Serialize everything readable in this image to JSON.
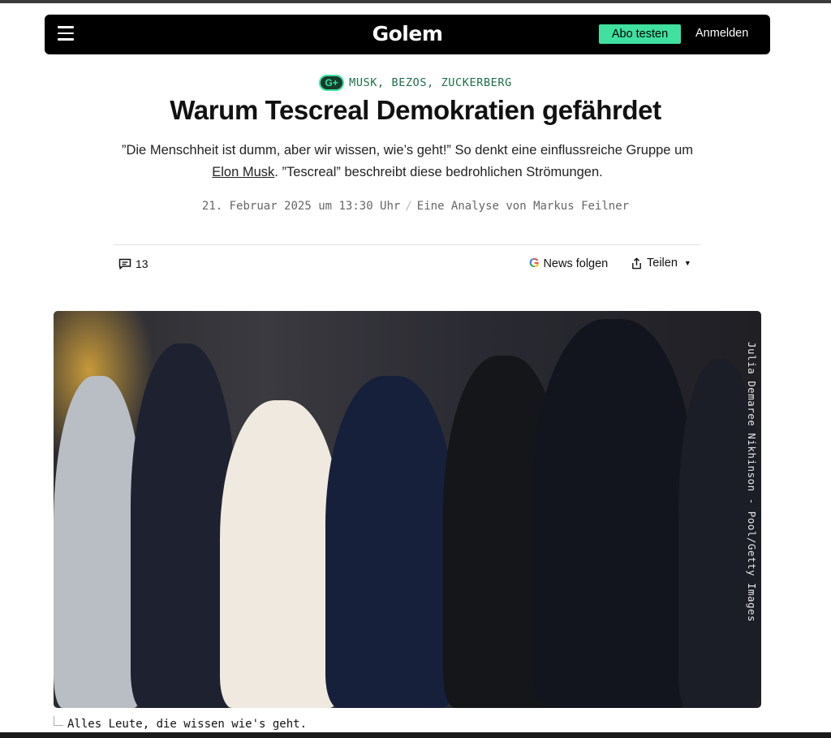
{
  "header": {
    "logo": "Golem",
    "subscribe_label": "Abo testen",
    "login_label": "Anmelden"
  },
  "article": {
    "plus_badge": "G+",
    "kicker": "MUSK, BEZOS, ZUCKERBERG",
    "title": "Warum Tescreal Demokratien gefährdet",
    "teaser_before": "”Die Menschheit ist dumm, aber wir wissen, wie’s geht!” So denkt eine einflussreiche Gruppe um ",
    "teaser_link": "Elon Musk",
    "teaser_after": ". ”Tescreal” beschreibt diese bedrohlichen Strömungen.",
    "date": "21. Februar 2025 um 13:30 Uhr",
    "byline": "Eine Analyse von Markus Feilner"
  },
  "actions": {
    "comment_count": "13",
    "news_follow_label": "News folgen",
    "google_letter": "G",
    "share_label": "Teilen"
  },
  "image": {
    "credit": "Julia Demaree Nikhinson - Pool/Getty Images",
    "caption": "Alles Leute, die wissen wie's geht."
  },
  "colors": {
    "accent_green": "#3fe0a0",
    "kicker_green": "#1e6e4a",
    "navbar_bg": "#000000"
  }
}
